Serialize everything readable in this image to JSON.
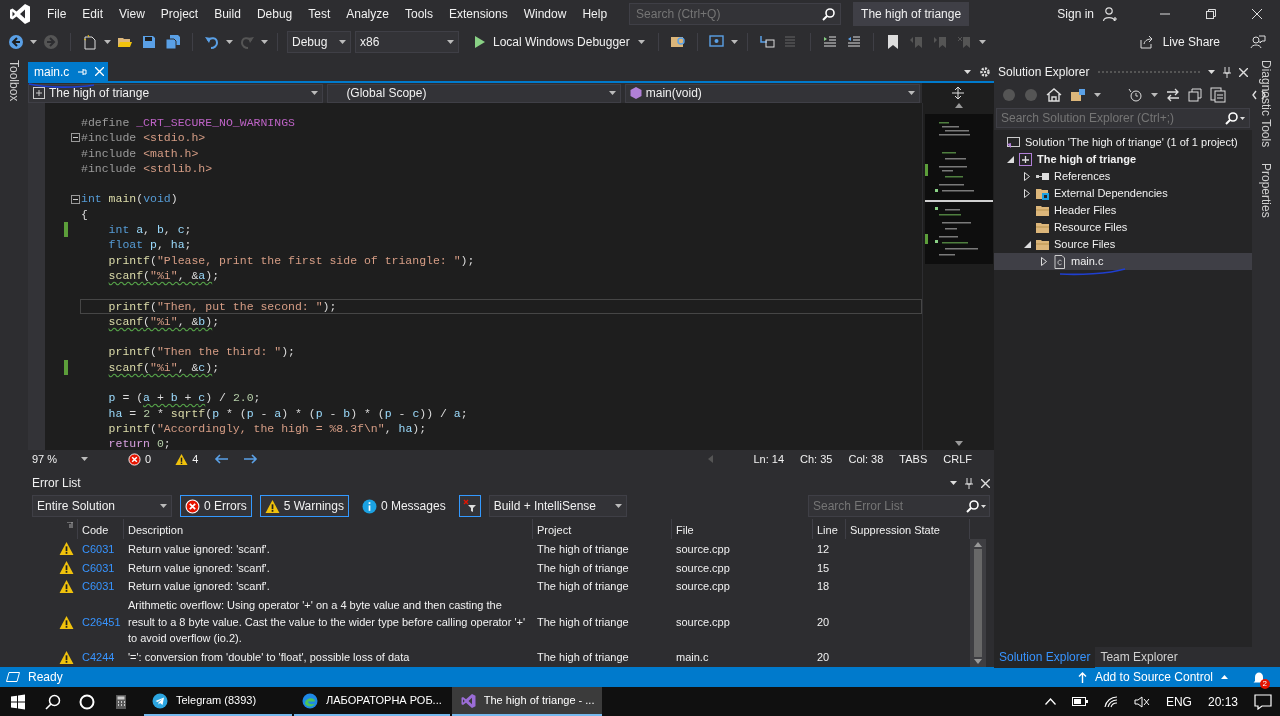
{
  "window": {
    "title": "The high of triange"
  },
  "menu": [
    "File",
    "Edit",
    "View",
    "Project",
    "Build",
    "Debug",
    "Test",
    "Analyze",
    "Tools",
    "Extensions",
    "Window",
    "Help"
  ],
  "search": {
    "placeholder": "Search (Ctrl+Q)"
  },
  "account": {
    "label": "Sign in"
  },
  "toolbar": {
    "configuration": "Debug",
    "platform": "x86",
    "start": "Local Windows Debugger",
    "live_share": "Live Share"
  },
  "side_tabs_left": [
    "Toolbox"
  ],
  "side_tabs_right": [
    "Diagnostic Tools",
    "Properties"
  ],
  "editor": {
    "tabs": [
      {
        "label": "main.c",
        "selected": true
      }
    ],
    "nav": {
      "project": "The high of triange",
      "scope": "(Global Scope)",
      "member": "main(void)"
    },
    "lines": [
      {
        "modified": false,
        "current": false,
        "fold": false,
        "indented": false,
        "tokens": [
          {
            "kind": "preprocessor",
            "text": "#define "
          },
          {
            "kind": "macro",
            "text": "_CRT_SECURE_NO_WARNINGS"
          }
        ]
      },
      {
        "modified": false,
        "current": false,
        "fold": true,
        "indented": false,
        "tokens": [
          {
            "kind": "preprocessor",
            "text": "#include "
          },
          {
            "kind": "string",
            "text": "<stdio.h>"
          }
        ]
      },
      {
        "modified": false,
        "current": false,
        "fold": false,
        "indented": false,
        "tokens": [
          {
            "kind": "preprocessor",
            "text": "#include "
          },
          {
            "kind": "string",
            "text": "<math.h>"
          }
        ]
      },
      {
        "modified": false,
        "current": false,
        "fold": false,
        "indented": false,
        "tokens": [
          {
            "kind": "preprocessor",
            "text": "#include "
          },
          {
            "kind": "string",
            "text": "<stdlib.h>"
          }
        ]
      },
      {
        "modified": false,
        "current": false,
        "fold": false
      },
      {
        "modified": false,
        "current": false,
        "fold": true,
        "indented": false,
        "tokens": [
          {
            "kind": "keyword",
            "text": "int "
          },
          {
            "kind": "function",
            "text": "main"
          },
          {
            "kind": "plain",
            "text": "("
          },
          {
            "kind": "keyword",
            "text": "void"
          },
          {
            "kind": "plain",
            "text": ")"
          }
        ]
      },
      {
        "modified": false,
        "current": false,
        "fold": false,
        "indented": false,
        "tokens": [
          {
            "kind": "plain",
            "text": "{"
          }
        ]
      },
      {
        "modified": true,
        "current": false,
        "fold": false,
        "indented": true,
        "tokens": [
          {
            "kind": "keyword",
            "text": "int "
          },
          {
            "kind": "variable",
            "text": "a"
          },
          {
            "kind": "plain",
            "text": ", "
          },
          {
            "kind": "variable",
            "text": "b"
          },
          {
            "kind": "plain",
            "text": ", "
          },
          {
            "kind": "variable",
            "text": "c"
          },
          {
            "kind": "plain",
            "text": ";"
          }
        ]
      },
      {
        "modified": false,
        "current": false,
        "fold": false,
        "indented": true,
        "tokens": [
          {
            "kind": "keyword",
            "text": "float "
          },
          {
            "kind": "variable",
            "text": "p"
          },
          {
            "kind": "plain",
            "text": ", "
          },
          {
            "kind": "variable",
            "text": "ha"
          },
          {
            "kind": "plain",
            "text": ";"
          }
        ]
      },
      {
        "modified": false,
        "current": false,
        "fold": false,
        "indented": true,
        "tokens": [
          {
            "kind": "function",
            "text": "printf"
          },
          {
            "kind": "plain",
            "text": "("
          },
          {
            "kind": "string",
            "text": "\"Please, print the first side of triangle: \""
          },
          {
            "kind": "plain",
            "text": ");"
          }
        ]
      },
      {
        "modified": false,
        "current": false,
        "fold": false,
        "indented": true,
        "tokens": [
          {
            "kind": "squiggle",
            "tokens": [
              {
                "kind": "function",
                "text": "scanf"
              },
              {
                "kind": "plain",
                "text": "("
              },
              {
                "kind": "string",
                "text": "\"%i\""
              },
              {
                "kind": "plain",
                "text": ", &"
              },
              {
                "kind": "variable",
                "text": "a"
              },
              {
                "kind": "plain",
                "text": ")"
              }
            ]
          },
          {
            "kind": "plain",
            "text": ";"
          }
        ]
      },
      {
        "modified": false,
        "current": false,
        "fold": false
      },
      {
        "modified": false,
        "current": true,
        "fold": false,
        "indented": true,
        "tokens": [
          {
            "kind": "function",
            "text": "printf"
          },
          {
            "kind": "plain",
            "text": "("
          },
          {
            "kind": "string",
            "text": "\"Then, put the second: \""
          },
          {
            "kind": "plain",
            "text": ");"
          }
        ]
      },
      {
        "modified": false,
        "current": false,
        "fold": false,
        "indented": true,
        "tokens": [
          {
            "kind": "squiggle",
            "tokens": [
              {
                "kind": "function",
                "text": "scanf"
              },
              {
                "kind": "plain",
                "text": "("
              },
              {
                "kind": "string",
                "text": "\"%i\""
              },
              {
                "kind": "plain",
                "text": ", &"
              },
              {
                "kind": "variable",
                "text": "b"
              },
              {
                "kind": "plain",
                "text": ")"
              }
            ]
          },
          {
            "kind": "plain",
            "text": ";"
          }
        ]
      },
      {
        "modified": false,
        "current": false,
        "fold": false
      },
      {
        "modified": false,
        "current": false,
        "fold": false,
        "indented": true,
        "tokens": [
          {
            "kind": "function",
            "text": "printf"
          },
          {
            "kind": "plain",
            "text": "("
          },
          {
            "kind": "string",
            "text": "\"Then the third: \""
          },
          {
            "kind": "plain",
            "text": ");"
          }
        ]
      },
      {
        "modified": true,
        "current": false,
        "fold": false,
        "indented": true,
        "tokens": [
          {
            "kind": "squiggle",
            "tokens": [
              {
                "kind": "function",
                "text": "scanf"
              },
              {
                "kind": "plain",
                "text": "("
              },
              {
                "kind": "string",
                "text": "\"%i\""
              },
              {
                "kind": "plain",
                "text": ", &"
              },
              {
                "kind": "variable",
                "text": "c"
              },
              {
                "kind": "plain",
                "text": ")"
              }
            ]
          },
          {
            "kind": "plain",
            "text": ";"
          }
        ]
      },
      {
        "modified": false,
        "current": false,
        "fold": false
      },
      {
        "modified": false,
        "current": false,
        "fold": false,
        "indented": true,
        "tokens": [
          {
            "kind": "variable",
            "text": "p"
          },
          {
            "kind": "plain",
            "text": " = ("
          },
          {
            "kind": "squiggle",
            "tokens": [
              {
                "kind": "variable",
                "text": "a"
              },
              {
                "kind": "plain",
                "text": " + "
              },
              {
                "kind": "variable",
                "text": "b"
              },
              {
                "kind": "plain",
                "text": " + "
              },
              {
                "kind": "variable",
                "text": "c"
              }
            ]
          },
          {
            "kind": "plain",
            "text": ") / "
          },
          {
            "kind": "number",
            "text": "2.0"
          },
          {
            "kind": "plain",
            "text": ";"
          }
        ]
      },
      {
        "modified": false,
        "current": false,
        "fold": false,
        "indented": true,
        "tokens": [
          {
            "kind": "variable",
            "text": "ha"
          },
          {
            "kind": "plain",
            "text": " = "
          },
          {
            "kind": "number",
            "text": "2"
          },
          {
            "kind": "plain",
            "text": " * "
          },
          {
            "kind": "function",
            "text": "sqrtf"
          },
          {
            "kind": "plain",
            "text": "("
          },
          {
            "kind": "variable",
            "text": "p"
          },
          {
            "kind": "plain",
            "text": " * ("
          },
          {
            "kind": "variable",
            "text": "p"
          },
          {
            "kind": "plain",
            "text": " - "
          },
          {
            "kind": "variable",
            "text": "a"
          },
          {
            "kind": "plain",
            "text": ") * ("
          },
          {
            "kind": "variable",
            "text": "p"
          },
          {
            "kind": "plain",
            "text": " - "
          },
          {
            "kind": "variable",
            "text": "b"
          },
          {
            "kind": "plain",
            "text": ") * ("
          },
          {
            "kind": "variable",
            "text": "p"
          },
          {
            "kind": "plain",
            "text": " - "
          },
          {
            "kind": "variable",
            "text": "c"
          },
          {
            "kind": "plain",
            "text": ")) / "
          },
          {
            "kind": "variable",
            "text": "a"
          },
          {
            "kind": "plain",
            "text": ";"
          }
        ]
      },
      {
        "modified": false,
        "current": false,
        "fold": false,
        "indented": true,
        "tokens": [
          {
            "kind": "function",
            "text": "printf"
          },
          {
            "kind": "plain",
            "text": "("
          },
          {
            "kind": "string",
            "text": "\"Accordingly, the high = %8.3f\\n\""
          },
          {
            "kind": "plain",
            "text": ", "
          },
          {
            "kind": "variable",
            "text": "ha"
          },
          {
            "kind": "plain",
            "text": ");"
          }
        ]
      },
      {
        "modified": false,
        "current": false,
        "fold": false,
        "indented": true,
        "tokens": [
          {
            "kind": "control",
            "text": "return "
          },
          {
            "kind": "number",
            "text": "0"
          },
          {
            "kind": "plain",
            "text": ";"
          }
        ]
      }
    ],
    "status": {
      "zoom": "97 %",
      "errors": "0",
      "warnings": "4",
      "line": "Ln: 14",
      "char": "Ch: 35",
      "col": "Col: 38",
      "indent": "TABS",
      "eol": "CRLF"
    }
  },
  "error_list": {
    "title": "Error List",
    "scope": "Entire Solution",
    "filters": [
      {
        "kind": "error",
        "label": "0 Errors",
        "selected": true
      },
      {
        "kind": "warning",
        "label": "5 Warnings",
        "selected": true
      },
      {
        "kind": "message",
        "label": "0 Messages",
        "selected": false
      }
    ],
    "source": "Build + IntelliSense",
    "search": {
      "placeholder": "Search Error List"
    },
    "columns": [
      "Code",
      "Description",
      "Project",
      "File",
      "Line",
      "Suppression State"
    ],
    "rows": [
      {
        "kind": "warning",
        "code": "C6031",
        "description": "Return value ignored: 'scanf'.",
        "project": "The high of triange",
        "file": "source.cpp",
        "line": "12"
      },
      {
        "kind": "warning",
        "code": "C6031",
        "description": "Return value ignored: 'scanf'.",
        "project": "The high of triange",
        "file": "source.cpp",
        "line": "15"
      },
      {
        "kind": "warning",
        "code": "C6031",
        "description": "Return value ignored: 'scanf'.",
        "project": "The high of triange",
        "file": "source.cpp",
        "line": "18"
      },
      {
        "kind": "warning",
        "code": "C26451",
        "description": "Arithmetic overflow: Using operator '+' on a 4 byte value and then casting the result to a 8 byte value. Cast the value to the wider type before calling operator '+' to avoid overflow (io.2).",
        "project": "The high of triange",
        "file": "source.cpp",
        "line": "20"
      },
      {
        "kind": "warning",
        "code": "C4244",
        "description": "'=': conversion from 'double' to 'float', possible loss of data",
        "project": "The high of triange",
        "file": "main.c",
        "line": "20"
      }
    ]
  },
  "solution_explorer": {
    "title": "Solution Explorer",
    "search": {
      "placeholder": "Search Solution Explorer (Ctrl+;)"
    },
    "tree": [
      {
        "label": "Solution 'The high of triange' (1 of 1 project)",
        "kind": "solution",
        "selected": false,
        "children": [
          {
            "label": "The high of triange",
            "kind": "project",
            "expanded": true,
            "selected": false,
            "children": [
              {
                "label": "References",
                "kind": "references",
                "expanded": false,
                "selected": false
              },
              {
                "label": "External Dependencies",
                "kind": "external",
                "expanded": false,
                "selected": false
              },
              {
                "label": "Header Files",
                "kind": "folder",
                "selected": false
              },
              {
                "label": "Resource Files",
                "kind": "folder",
                "selected": false
              },
              {
                "label": "Source Files",
                "kind": "folder",
                "expanded": true,
                "selected": false,
                "children": [
                  {
                    "label": "main.c",
                    "kind": "file",
                    "expanded": false,
                    "selected": true
                  }
                ]
              }
            ]
          }
        ]
      }
    ],
    "tabs": [
      {
        "label": "Solution Explorer",
        "selected": true
      },
      {
        "label": "Team Explorer",
        "selected": false
      }
    ]
  },
  "status_bar": {
    "text": "Ready",
    "source_control": "Add to Source Control",
    "notifications": "2"
  },
  "taskbar": {
    "apps": [
      {
        "kind": "telegram",
        "label": "Telegram (8393)",
        "selected": false
      },
      {
        "kind": "edge",
        "label": "ЛАБОРАТОРНА РОБ...",
        "selected": false
      },
      {
        "kind": "vs",
        "label": "The high of triange - ...",
        "selected": true
      }
    ],
    "language": "ENG",
    "time": "20:13"
  }
}
